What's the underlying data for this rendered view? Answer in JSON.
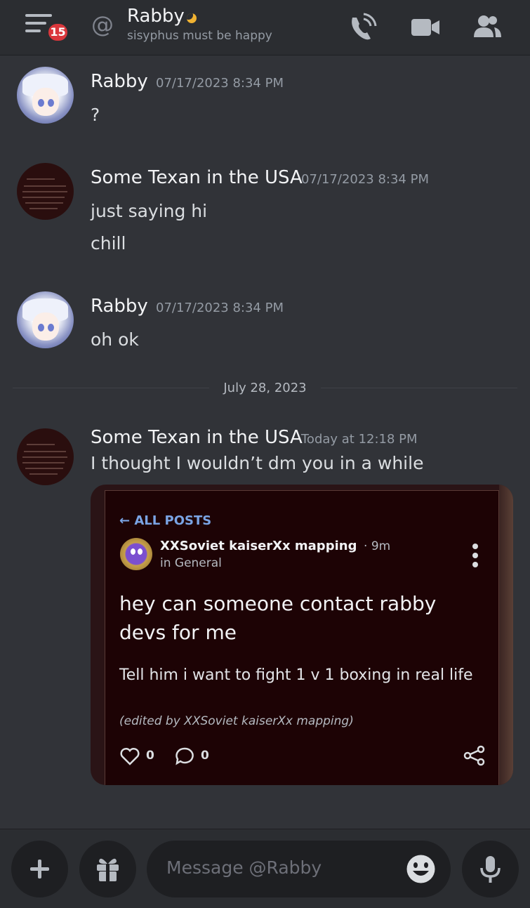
{
  "header": {
    "notification_count": "15",
    "channel_title": "Rabby",
    "status_text": "sisyphus must be happy",
    "status_color": "#f0b232"
  },
  "messages": [
    {
      "author": "Rabby",
      "timestamp": "07/17/2023 8:34 PM",
      "lines": [
        "?"
      ]
    },
    {
      "author": "Some Texan in the USA",
      "timestamp": "07/17/2023 8:34 PM",
      "lines": [
        "just saying hi",
        "chill"
      ]
    },
    {
      "author": "Rabby",
      "timestamp": "07/17/2023 8:34 PM",
      "lines": [
        "oh ok"
      ]
    },
    {
      "author": "Some Texan in the USA",
      "timestamp": "Today at 12:18 PM",
      "lines": [
        "I thought I wouldn’t dm you in a while"
      ]
    }
  ],
  "date_divider": "July 28, 2023",
  "embed": {
    "back_label": "ALL POSTS",
    "post_author": "XXSoviet kaiserXx mapping",
    "post_time": "9m",
    "post_location": "in General",
    "post_title": "hey can someone contact rabby devs for me",
    "post_body": "Tell him i want to fight 1 v 1 boxing in real life",
    "edited_note": "(edited by XXSoviet kaiserXx mapping)",
    "likes": "0",
    "comments": "0"
  },
  "composer": {
    "placeholder": "Message @Rabby"
  },
  "icons": {
    "menu": "hamburger-menu-icon",
    "at": "at-sign-icon",
    "call": "phone-call-icon",
    "video": "video-camera-icon",
    "members": "members-icon",
    "add": "plus-icon",
    "gift": "gift-icon",
    "emoji": "emoji-icon",
    "mic": "microphone-icon",
    "heart": "heart-icon",
    "comment": "comment-bubble-icon",
    "share": "share-icon",
    "back": "arrow-left-icon"
  },
  "colors": {
    "background": "#313338",
    "header": "#2b2d31",
    "link": "#7aa4e4",
    "badge": "#da373c"
  }
}
